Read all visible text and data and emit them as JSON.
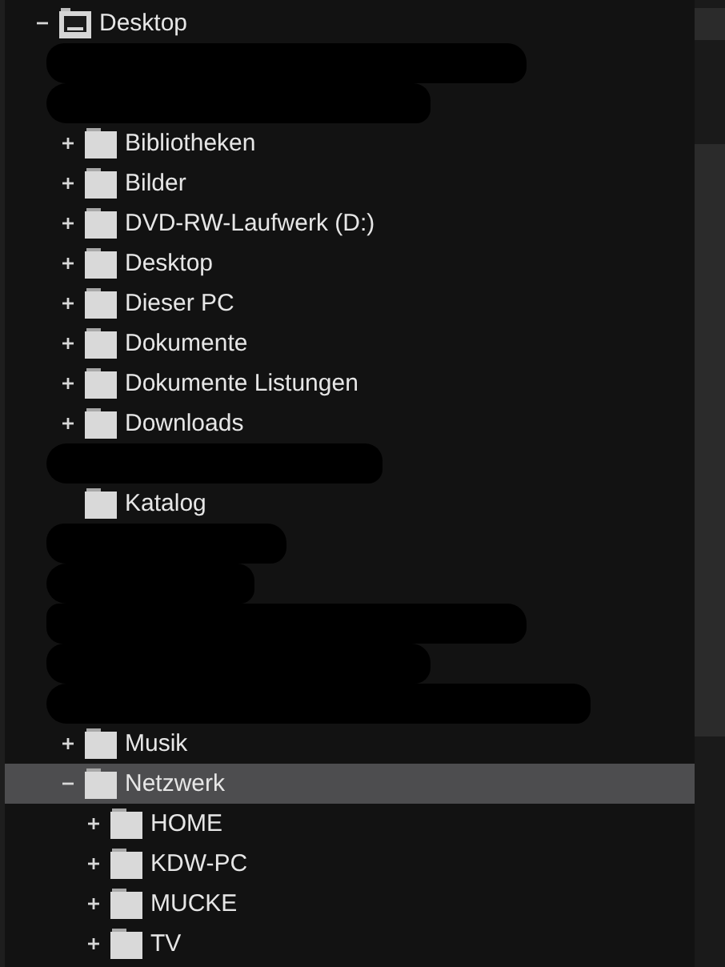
{
  "tree": [
    {
      "kind": "desktop",
      "label": "Desktop",
      "expandable": true,
      "expanded": true,
      "selected": false,
      "children": [
        {
          "kind": "redacted"
        },
        {
          "kind": "redacted"
        },
        {
          "kind": "folder",
          "label": "Bibliotheken",
          "expandable": true,
          "expanded": false,
          "selected": false
        },
        {
          "kind": "folder",
          "label": "Bilder",
          "expandable": true,
          "expanded": false,
          "selected": false
        },
        {
          "kind": "folder",
          "label": "DVD-RW-Laufwerk (D:)",
          "expandable": true,
          "expanded": false,
          "selected": false
        },
        {
          "kind": "folder",
          "label": "Desktop",
          "expandable": true,
          "expanded": false,
          "selected": false
        },
        {
          "kind": "folder",
          "label": "Dieser PC",
          "expandable": true,
          "expanded": false,
          "selected": false
        },
        {
          "kind": "folder",
          "label": "Dokumente",
          "expandable": true,
          "expanded": false,
          "selected": false
        },
        {
          "kind": "folder",
          "label": "Dokumente Listungen",
          "expandable": true,
          "expanded": false,
          "selected": false
        },
        {
          "kind": "folder",
          "label": "Downloads",
          "expandable": true,
          "expanded": false,
          "selected": false
        },
        {
          "kind": "redacted"
        },
        {
          "kind": "folder",
          "label": "Katalog",
          "expandable": false,
          "expanded": false,
          "selected": false
        },
        {
          "kind": "redacted"
        },
        {
          "kind": "redacted"
        },
        {
          "kind": "redacted"
        },
        {
          "kind": "redacted"
        },
        {
          "kind": "redacted"
        },
        {
          "kind": "folder",
          "label": "Musik",
          "expandable": true,
          "expanded": false,
          "selected": false
        },
        {
          "kind": "folder",
          "label": "Netzwerk",
          "expandable": true,
          "expanded": true,
          "selected": true,
          "children": [
            {
              "kind": "folder",
              "label": "HOME",
              "expandable": true,
              "expanded": false,
              "selected": false
            },
            {
              "kind": "folder",
              "label": "KDW-PC",
              "expandable": true,
              "expanded": false,
              "selected": false
            },
            {
              "kind": "folder",
              "label": "MUCKE",
              "expandable": true,
              "expanded": false,
              "selected": false
            },
            {
              "kind": "folder",
              "label": "TV",
              "expandable": true,
              "expanded": false,
              "selected": false
            }
          ]
        }
      ]
    }
  ]
}
